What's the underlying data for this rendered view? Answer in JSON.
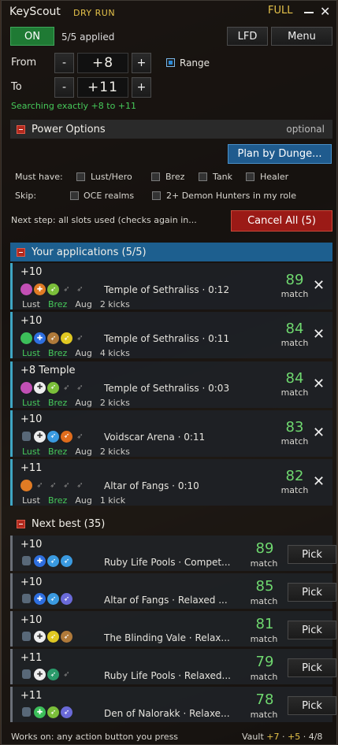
{
  "header": {
    "title": "KeyScout",
    "mode": "DRY RUN",
    "status": "FULL",
    "minimize": "—",
    "close": "✕"
  },
  "top": {
    "on_label": "ON",
    "applied": "5/5 applied",
    "lfd_label": "LFD",
    "menu_label": "Menu"
  },
  "range": {
    "from_label": "From",
    "to_label": "To",
    "from_value": "+8",
    "to_value": "+11",
    "minus": "-",
    "plus": "+",
    "range_label": "Range",
    "range_checked": true,
    "searching": "Searching exactly +8 to +11"
  },
  "power": {
    "title": "Power Options",
    "optional": "optional",
    "plan_label": "Plan by Dunge...",
    "must_have": "Must have:",
    "lust": "Lust/Hero",
    "brez": "Brez",
    "tank": "Tank",
    "healer": "Healer",
    "skip": "Skip:",
    "oce": "OCE realms",
    "dh": "2+ Demon Hunters in my role",
    "next_step": "Next step: all slots used (checks again in...",
    "cancel_label": "Cancel All (5)"
  },
  "applications": {
    "title": "Your applications (5/5)",
    "items": [
      {
        "level": "+10",
        "dungeon": "Temple of Sethraliss",
        "time": "0:12",
        "score": "89",
        "match": "match",
        "tags": [
          "Lust",
          "Brez",
          "Aug",
          "2 kicks"
        ],
        "icons": [
          "tank",
          "heal",
          "dpsg",
          "empty",
          "empty"
        ]
      },
      {
        "level": "+10",
        "dungeon": "Temple of Sethraliss",
        "time": "0:11",
        "score": "84",
        "match": "match",
        "tags": [
          "Lust",
          "Brez",
          "Aug",
          "4 kicks"
        ],
        "icons": [
          "tank gr",
          "healb",
          "dpst",
          "dpsy",
          "empty"
        ]
      },
      {
        "level": "+8 Temple",
        "dungeon": "Temple of Sethraliss",
        "time": "0:03",
        "score": "84",
        "match": "match",
        "tags": [
          "Lust",
          "Brez",
          "Aug",
          "2 kicks"
        ],
        "icons": [
          "tank",
          "healw",
          "dpsg",
          "empty",
          "empty"
        ]
      },
      {
        "level": "+10",
        "dungeon": "Voidscar Arena",
        "time": "0:11",
        "score": "83",
        "match": "match",
        "tags": [
          "Lust",
          "Brez",
          "Aug",
          "2 kicks"
        ],
        "icons": [
          "tank sm",
          "healw",
          "dps",
          "dpso",
          "empty"
        ]
      },
      {
        "level": "+11",
        "dungeon": "Altar of Fangs",
        "time": "0:10",
        "score": "82",
        "match": "match",
        "tags": [
          "Lust",
          "Brez",
          "Aug",
          "1 kick"
        ],
        "icons": [
          "tank or",
          "empty",
          "empty",
          "empty",
          "empty"
        ]
      }
    ]
  },
  "next_best": {
    "title": "Next best (35)",
    "pick_label": "Pick",
    "items": [
      {
        "level": "+10",
        "dungeon": "Ruby Life Pools",
        "detail": "Compet...",
        "score": "89",
        "match": "match",
        "icons": [
          "tank sm",
          "healb",
          "dps",
          "dps"
        ]
      },
      {
        "level": "+10",
        "dungeon": "Altar of Fangs",
        "detail": "Relaxed ...",
        "score": "85",
        "match": "match",
        "icons": [
          "tank sm",
          "healb",
          "dps",
          "dpsp"
        ]
      },
      {
        "level": "+10",
        "dungeon": "The Blinding Vale",
        "detail": "Relax...",
        "score": "81",
        "match": "match",
        "icons": [
          "tank sm",
          "healw",
          "dpsy",
          "dpst"
        ]
      },
      {
        "level": "+11",
        "dungeon": "Ruby Life Pools",
        "detail": "Relaxed...",
        "score": "79",
        "match": "match",
        "icons": [
          "tank sm",
          "healw",
          "dpsx",
          "empty"
        ]
      },
      {
        "level": "+11",
        "dungeon": "Den of Nalorakk",
        "detail": "Relaxe...",
        "score": "78",
        "match": "match",
        "icons": [
          "tank sm",
          "healg",
          "dpsg",
          "dpsp"
        ]
      }
    ]
  },
  "footer": {
    "works_on": "Works on: any action button you press",
    "vault_label": "Vault",
    "vault_a": "+7",
    "vault_b": "+5",
    "vault_c": "4/8"
  },
  "colors": {
    "accent_green": "#46c95a",
    "score_green": "#6fd86f",
    "gold": "#e6c34a",
    "cancel_red": "#9b1a16",
    "blue": "#1f5b8e"
  }
}
